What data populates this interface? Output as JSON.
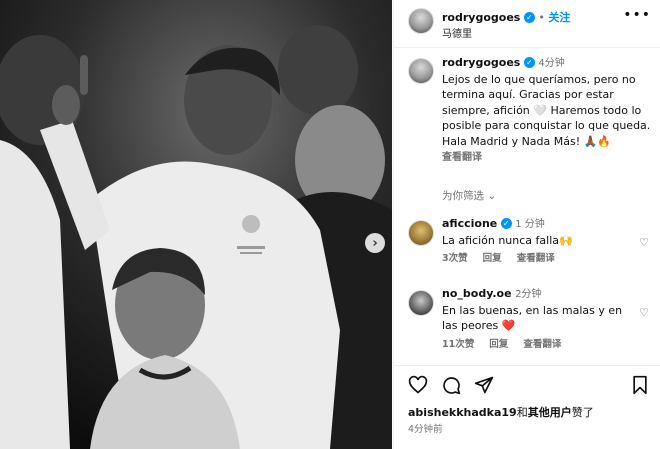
{
  "post": {
    "username": "rodrygogoes",
    "follow_label": "关注",
    "location": "马德里",
    "more_label": "•••"
  },
  "caption": {
    "username": "rodrygogoes",
    "time": "4分钟",
    "text": "Lejos de lo que queríamos, pero no termina aquí. Gracias por estar siempre, afición 🤍 Haremos todo lo posible para conquistar lo que queda. Hala Madrid y Nada Más! 🙏🏾🔥",
    "translate_label": "查看翻译"
  },
  "for_you_label": "为你筛选",
  "comments": [
    {
      "username": "aficcione",
      "time": "1 分钟",
      "text": "La afición nunca falla🙌",
      "likes": "3次赞",
      "reply_label": "回复",
      "translate_label": "查看翻译"
    },
    {
      "username": "no_body.oe",
      "time": "2分钟",
      "text": "En las buenas, en las malas y en las peores ❤️",
      "likes": "11次赞",
      "reply_label": "回复",
      "translate_label": "查看翻译"
    }
  ],
  "likes_line": {
    "user": "abishekkhadka19",
    "connector": "和",
    "others": "其他用户",
    "suffix": "赞了"
  },
  "post_time": "4分钟前",
  "icons": {
    "like": "heart-icon",
    "comment": "comment-icon",
    "share": "share-icon",
    "save": "bookmark-icon",
    "next": "chevron-right-icon"
  }
}
